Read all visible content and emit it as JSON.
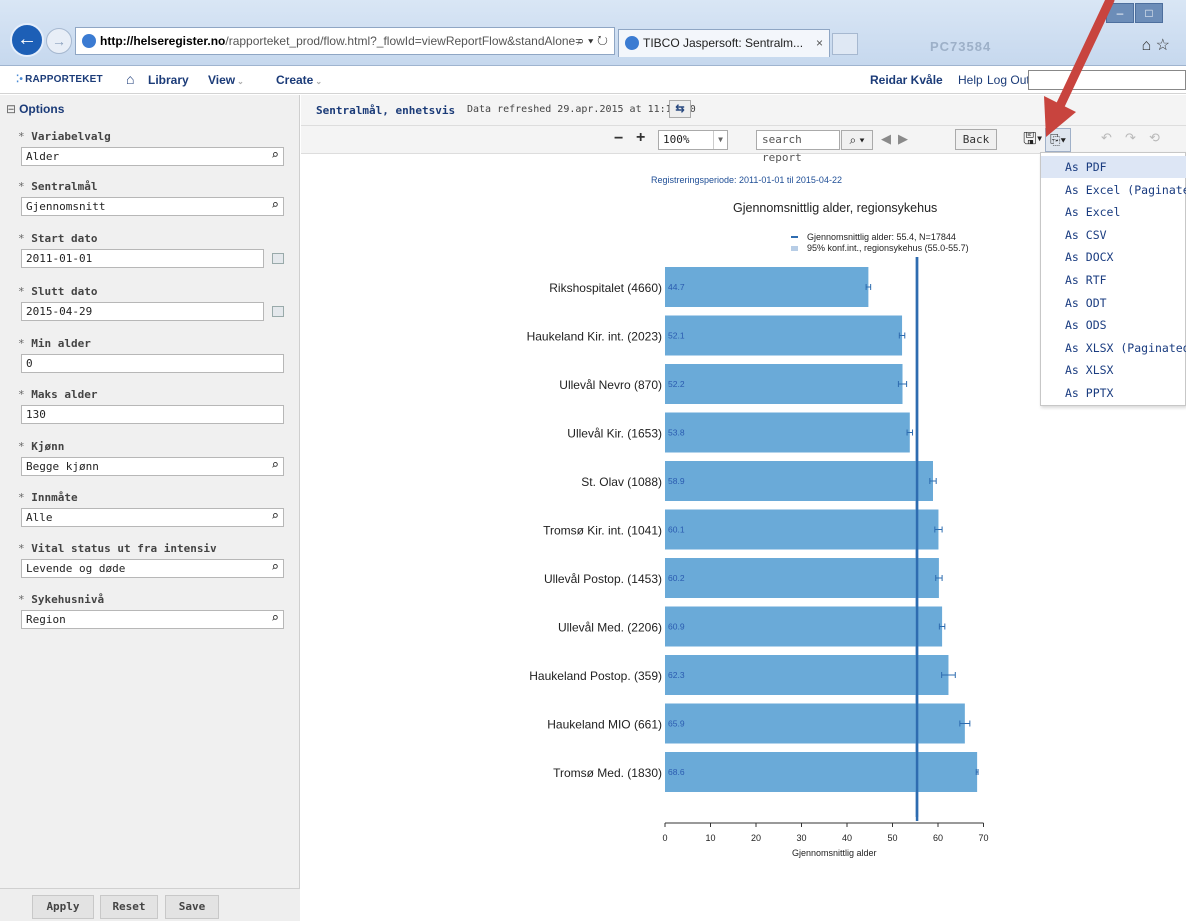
{
  "browser": {
    "url_host": "http://helseregister.no",
    "url_rest": "/rapporteket_prod/flow.html?_flowId=viewReportFlow&standAlone=",
    "tab_title": "TIBCO Jaspersoft: Sentralm...",
    "tab_close": "×",
    "watermark": "PC73584"
  },
  "nav": {
    "logo": "RAPPORTEKET",
    "library": "Library",
    "view": "View",
    "create": "Create",
    "user": "Reidar Kvåle",
    "help": "Help",
    "logout": "Log Out"
  },
  "options": {
    "header": "Options",
    "controls": [
      {
        "label": "Variabelvalg",
        "value": "Alder"
      },
      {
        "label": "Sentralmål",
        "value": "Gjennomsnitt"
      },
      {
        "label": "Start dato",
        "value": "2011-01-01"
      },
      {
        "label": "Slutt dato",
        "value": "2015-04-29"
      },
      {
        "label": "Min alder",
        "value": "0"
      },
      {
        "label": "Maks alder",
        "value": "130"
      },
      {
        "label": "Kjønn",
        "value": "Begge kjønn"
      },
      {
        "label": "Innmåte",
        "value": "Alle"
      },
      {
        "label": "Vital status ut fra intensiv",
        "value": "Levende og døde"
      },
      {
        "label": "Sykehusnivå",
        "value": "Region"
      }
    ],
    "required_mark": "*",
    "apply": "Apply",
    "reset": "Reset",
    "save": "Save"
  },
  "report": {
    "title": "Sentralmål, enhetsvis",
    "refreshed": "Data refreshed 29.apr.2015 at 11:14:10"
  },
  "toolbar": {
    "zoom": "100%",
    "search_placeholder": "search report",
    "back": "Back"
  },
  "export_menu": {
    "items": [
      "As PDF",
      "As Excel (Paginated)",
      "As Excel",
      "As CSV",
      "As DOCX",
      "As RTF",
      "As ODT",
      "As ODS",
      "As XLSX (Paginated)",
      "As XLSX",
      "As PPTX"
    ]
  },
  "colors": {
    "bar": "#6aaad8",
    "mean_line": "#2e6cb0",
    "arrow": "#c8443e",
    "nav_text": "#1b3b78"
  },
  "chart_data": {
    "type": "bar",
    "orientation": "horizontal",
    "subtitle": "Registreringsperiode: 2011-01-01 til 2015-04-22",
    "title": "Gjennomsnittlig alder, regionsykehus",
    "legend": [
      "Gjennomsnittlig alder: 55.4, N=17844",
      "95% konf.int., regionsykehus (55.0-55.7)"
    ],
    "xlabel": "Gjennomsnittlig alder",
    "xlim": [
      0,
      70
    ],
    "xticks": [
      0,
      10,
      20,
      30,
      40,
      50,
      60,
      70
    ],
    "mean": 55.4,
    "ci": [
      55.0,
      55.7
    ],
    "categories": [
      "Rikshospitalet (4660)",
      "Haukeland Kir. int. (2023)",
      "Ullevål Nevro (870)",
      "Ullevål Kir. (1653)",
      "St. Olav (1088)",
      "Tromsø Kir. int. (1041)",
      "Ullevål Postop. (1453)",
      "Ullevål Med. (2206)",
      "Haukeland Postop. (359)",
      "Haukeland MIO (661)",
      "Tromsø Med. (1830)"
    ],
    "values": [
      44.7,
      52.1,
      52.2,
      53.8,
      58.9,
      60.1,
      60.2,
      60.9,
      62.3,
      65.9,
      68.6
    ],
    "value_labels": [
      "44.7",
      "52.1",
      "52.2",
      "53.8",
      "58.9",
      "60.1",
      "60.2",
      "60.9",
      "62.3",
      "65.9",
      "68.6"
    ],
    "error_low": [
      44.2,
      51.5,
      51.3,
      53.2,
      58.2,
      59.3,
      59.5,
      60.3,
      60.8,
      64.8,
      68.4
    ],
    "error_high": [
      45.2,
      52.7,
      53.1,
      54.4,
      59.6,
      60.9,
      60.9,
      61.5,
      63.8,
      67.0,
      68.8
    ]
  }
}
